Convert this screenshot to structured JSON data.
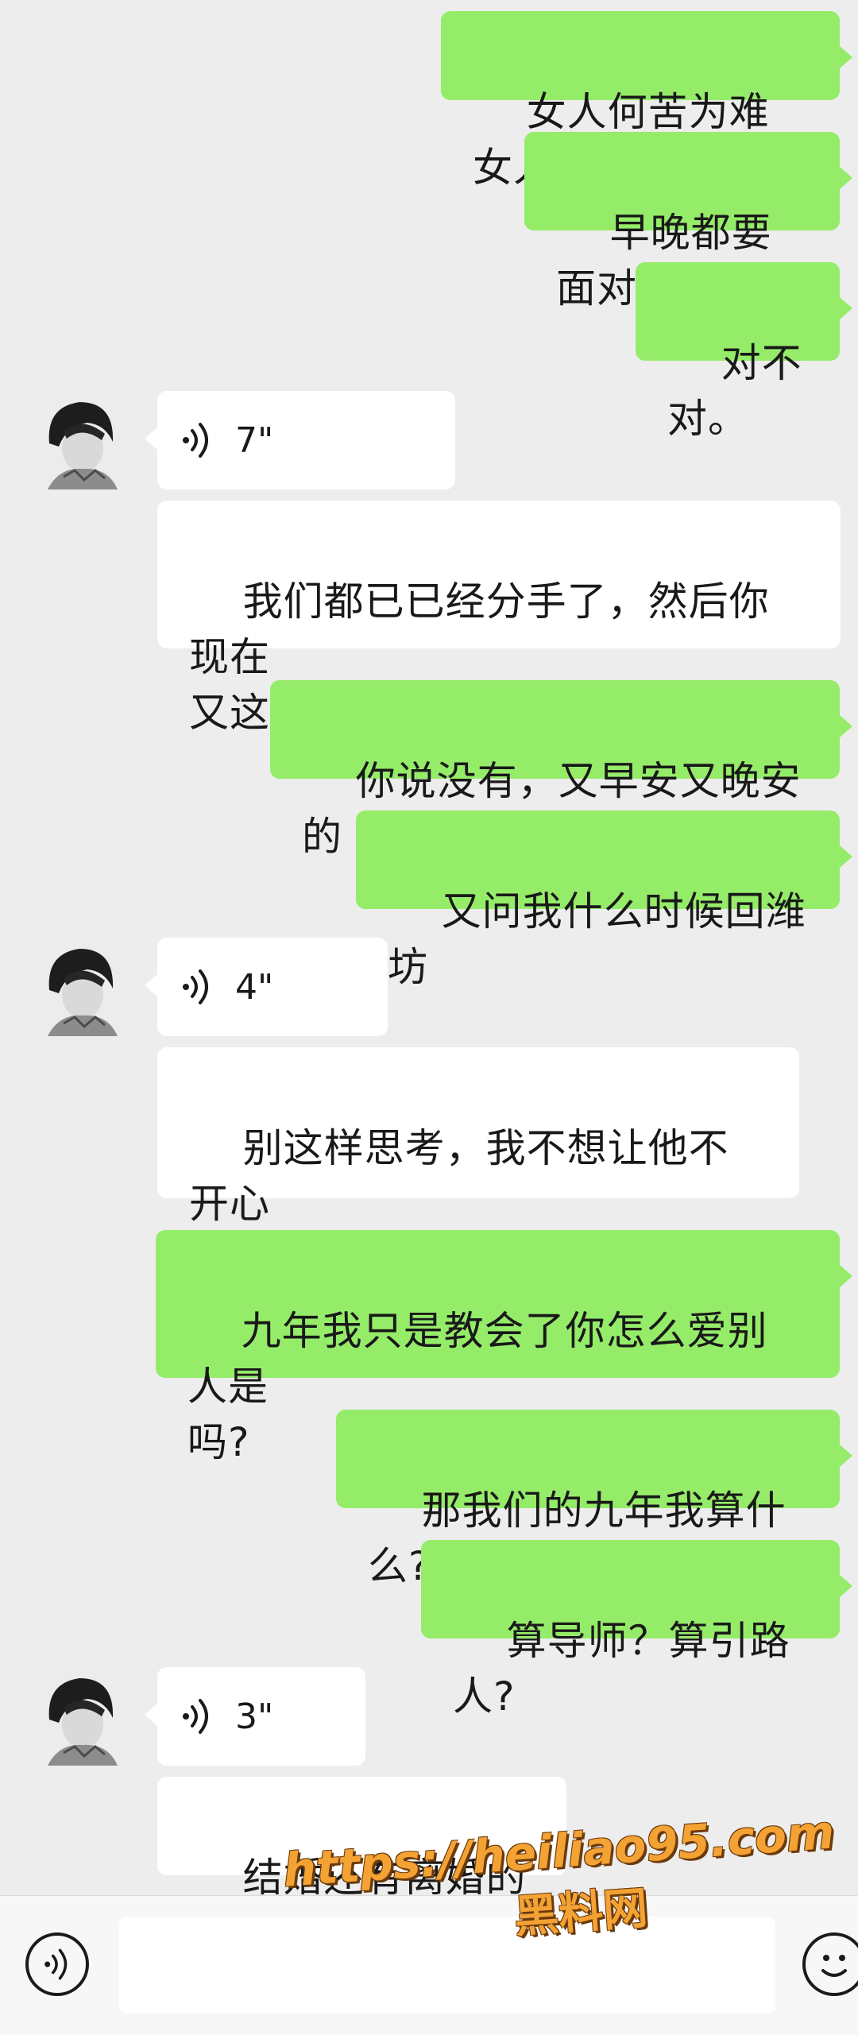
{
  "messages": {
    "m1": "女人何苦为难女人",
    "m2": "早晚都要面对",
    "m3": "对不对。",
    "v1": "7\"",
    "m4": "我们都已已经分手了，然后你现在\n又这样，是在干嘛呢?",
    "m5": "你说没有，又早安又晚安的",
    "m6": "又问我什么时候回潍坊",
    "v2": "4\"",
    "m7a": "别这样思考，我不想让他不开心",
    "m7b": "。",
    "m8": "九年我只是教会了你怎么爱别人是\n吗?",
    "m9": "那我们的九年我算什么?",
    "m10": "算导师？算引路人?",
    "v3": "3\"",
    "m11": "结婚还有离婚的呢?"
  },
  "watermark": {
    "url": "https://heiliao95.com",
    "site": "黑料网"
  },
  "colors": {
    "background": "#ededed",
    "self_bubble": "#95ec69",
    "other_bubble": "#ffffff",
    "watermark": "#f4a234"
  },
  "icons": {
    "voice_message": "voice-wave-icon",
    "input_voice": "voice-toggle-icon",
    "input_emoji": "emoji-icon",
    "crying_emoji": "crying-face-emoji"
  }
}
